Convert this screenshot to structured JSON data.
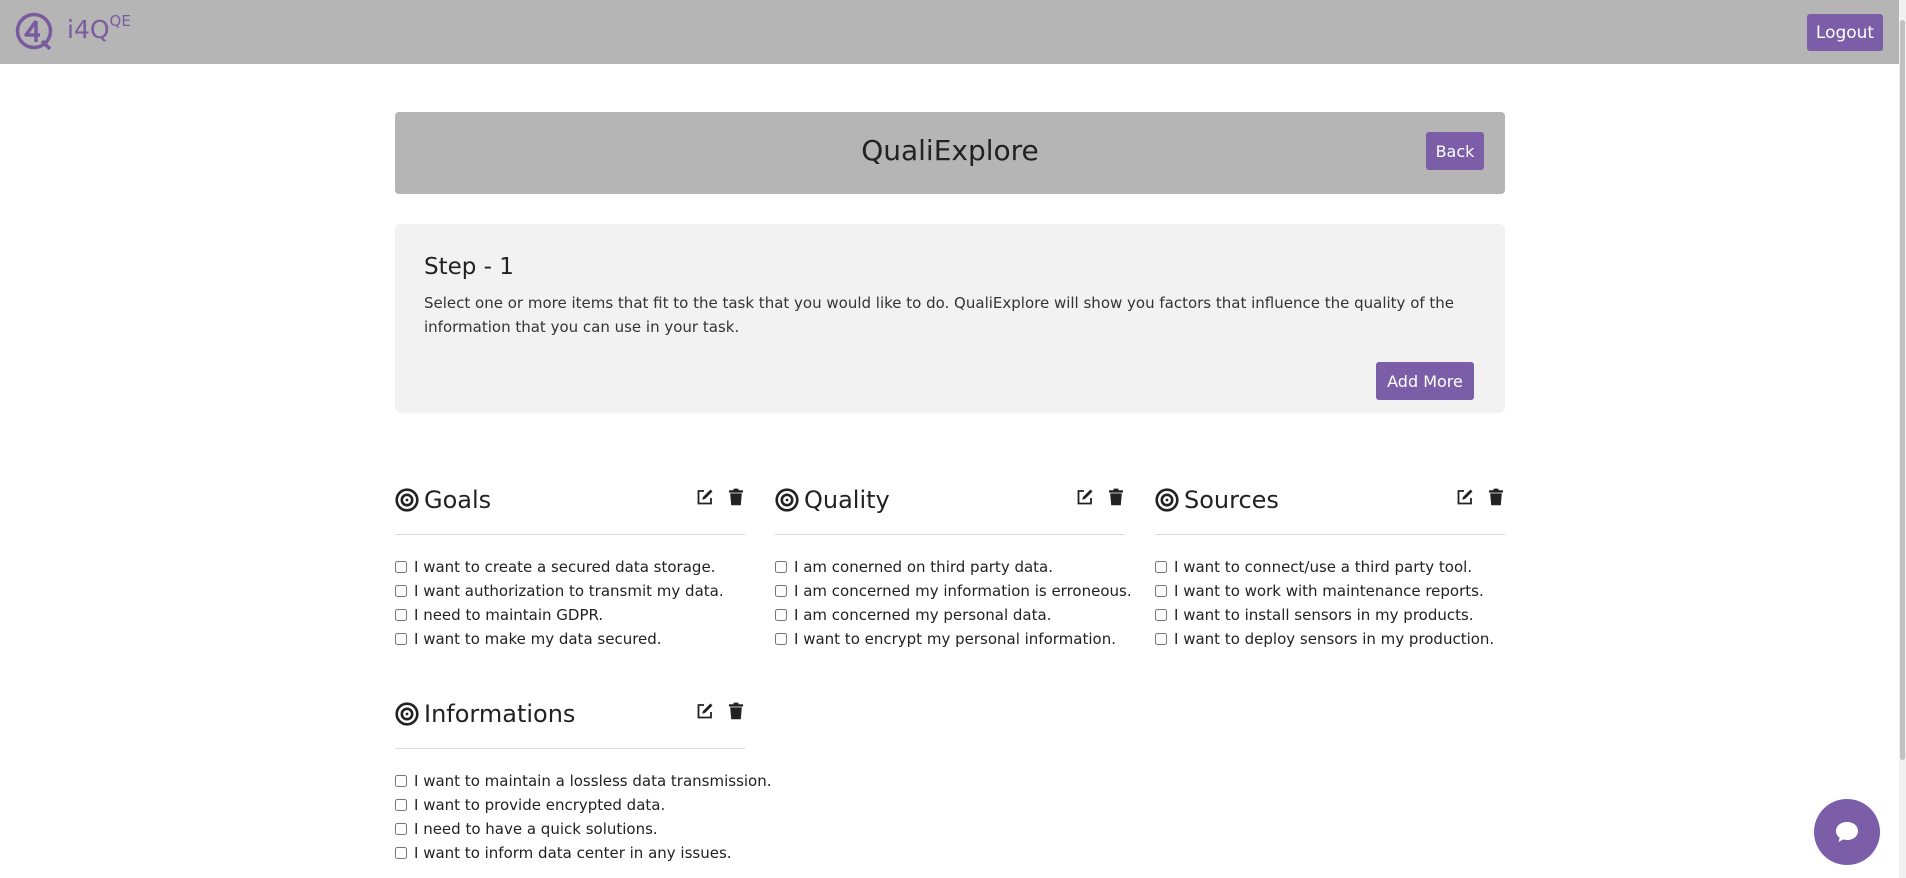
{
  "brand": {
    "name": "i4Q",
    "superscript": "QE",
    "color": "#7a5c9e"
  },
  "topbar": {
    "logout_label": "Logout"
  },
  "header": {
    "title": "QualiExplore",
    "back_label": "Back"
  },
  "step": {
    "title": "Step - 1",
    "description": "Select one or more items that fit to the task that you would like to do. QualiExplore will show you factors that influence the quality of the information that you can use in your task.",
    "add_more_label": "Add More"
  },
  "sections": [
    {
      "title": "Goals",
      "items": [
        "I want to create a secured data storage.",
        "I want authorization to transmit my data.",
        "I need to maintain GDPR.",
        "I want to make my data secured."
      ]
    },
    {
      "title": "Quality",
      "items": [
        "I am conerned on third party data.",
        "I am concerned my information is erroneous.",
        "I am concerned my personal data.",
        "I want to encrypt my personal information."
      ]
    },
    {
      "title": "Sources",
      "items": [
        "I want to connect/use a third party tool.",
        "I want to work with maintenance reports.",
        "I want to install sensors in my products.",
        "I want to deploy sensors in my production."
      ]
    },
    {
      "title": "Informations",
      "items": [
        "I want to maintain a lossless data transmission.",
        "I want to provide encrypted data.",
        "I need to have a quick solutions.",
        "I want to inform data center in any issues."
      ]
    }
  ],
  "icons": {
    "section": "target-icon",
    "edit": "edit-icon",
    "delete": "trash-icon",
    "chat": "chat-bubble-icon",
    "logo": "i4q-logo-icon"
  },
  "colors": {
    "accent": "#7b5ea7",
    "topbar": "#b5b5b5",
    "card": "#f2f2f2"
  }
}
